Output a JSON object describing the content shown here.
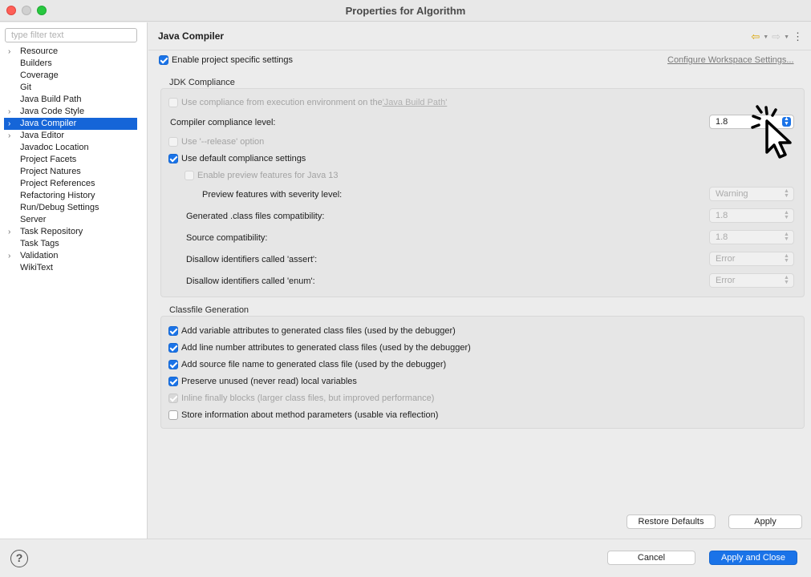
{
  "window": {
    "title": "Properties for Algorithm"
  },
  "sidebar": {
    "filter_placeholder": "type filter text",
    "items": [
      {
        "label": "Resource",
        "expandable": true
      },
      {
        "label": "Builders",
        "expandable": false
      },
      {
        "label": "Coverage",
        "expandable": false
      },
      {
        "label": "Git",
        "expandable": false
      },
      {
        "label": "Java Build Path",
        "expandable": false
      },
      {
        "label": "Java Code Style",
        "expandable": true
      },
      {
        "label": "Java Compiler",
        "expandable": true,
        "selected": true
      },
      {
        "label": "Java Editor",
        "expandable": true
      },
      {
        "label": "Javadoc Location",
        "expandable": false
      },
      {
        "label": "Project Facets",
        "expandable": false
      },
      {
        "label": "Project Natures",
        "expandable": false
      },
      {
        "label": "Project References",
        "expandable": false
      },
      {
        "label": "Refactoring History",
        "expandable": false
      },
      {
        "label": "Run/Debug Settings",
        "expandable": false
      },
      {
        "label": "Server",
        "expandable": false
      },
      {
        "label": "Task Repository",
        "expandable": true
      },
      {
        "label": "Task Tags",
        "expandable": false
      },
      {
        "label": "Validation",
        "expandable": true
      },
      {
        "label": "WikiText",
        "expandable": false
      }
    ]
  },
  "page": {
    "title": "Java Compiler",
    "enable_project_specific": "Enable project specific settings",
    "configure_workspace_link": "Configure Workspace Settings..."
  },
  "jdk": {
    "group_title": "JDK Compliance",
    "use_compliance_prefix": "Use compliance from execution environment on the ",
    "use_compliance_link": "'Java Build Path'",
    "compliance_level_label": "Compiler compliance level:",
    "compliance_level_value": "1.8",
    "use_release_label": "Use '--release' option",
    "use_default_label": "Use default compliance settings",
    "enable_preview_label": "Enable preview features for Java 13",
    "preview_severity_label": "Preview features with severity level:",
    "preview_severity_value": "Warning",
    "generated_class_label": "Generated .class files compatibility:",
    "generated_class_value": "1.8",
    "source_compat_label": "Source compatibility:",
    "source_compat_value": "1.8",
    "assert_label": "Disallow identifiers called 'assert':",
    "assert_value": "Error",
    "enum_label": "Disallow identifiers called 'enum':",
    "enum_value": "Error"
  },
  "classfile": {
    "group_title": "Classfile Generation",
    "options": [
      {
        "label": "Add variable attributes to generated class files (used by the debugger)",
        "state": "on"
      },
      {
        "label": "Add line number attributes to generated class files (used by the debugger)",
        "state": "on"
      },
      {
        "label": "Add source file name to generated class file (used by the debugger)",
        "state": "on"
      },
      {
        "label": "Preserve unused (never read) local variables",
        "state": "on"
      },
      {
        "label": "Inline finally blocks (larger class files, but improved performance)",
        "state": "dis-on"
      },
      {
        "label": "Store information about method parameters (usable via reflection)",
        "state": "off"
      }
    ]
  },
  "buttons": {
    "restore_defaults": "Restore Defaults",
    "apply": "Apply",
    "cancel": "Cancel",
    "apply_and_close": "Apply and Close",
    "help": "?"
  },
  "icons": {
    "back": "back-arrow-icon",
    "forward": "forward-arrow-icon",
    "view_menu": "view-menu-icon",
    "help": "help-icon",
    "cursor": "click-cursor-icon"
  },
  "colors": {
    "accent": "#1a73e8",
    "selection": "#1565d8"
  }
}
